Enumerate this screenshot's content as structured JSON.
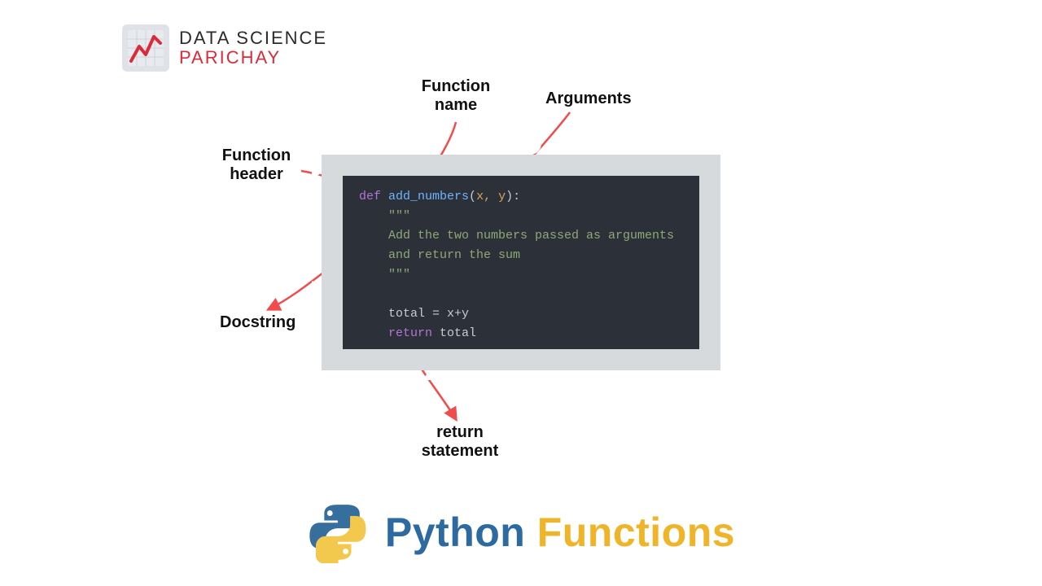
{
  "logo": {
    "line1": "DATA SCIENCE",
    "line2": "PARICHAY"
  },
  "labels": {
    "function_name": "Function\nname",
    "arguments": "Arguments",
    "function_header": "Function\nheader",
    "docstring": "Docstring",
    "return_statement": "return\nstatement"
  },
  "code": {
    "def": "def ",
    "name": "add_numbers",
    "lparen": "(",
    "params": "x, y",
    "rparen_colon": "):",
    "tripleq1": "    \"\"\"",
    "doc1": "    Add the two numbers passed as arguments",
    "doc2": "    and return the sum",
    "tripleq2": "    \"\"\"",
    "blank": "",
    "assign": "    total = x+y",
    "ret_kw": "    return ",
    "ret_val": "total"
  },
  "title": {
    "python": "Python ",
    "functions": "Functions"
  },
  "colors": {
    "arrow": "#f24b4b",
    "code_bg": "#2b3039",
    "stamp_bg": "#d7dadd",
    "brand_red": "#d92b3a",
    "title_blue": "#2c6aa0",
    "title_yellow": "#f0b429"
  }
}
